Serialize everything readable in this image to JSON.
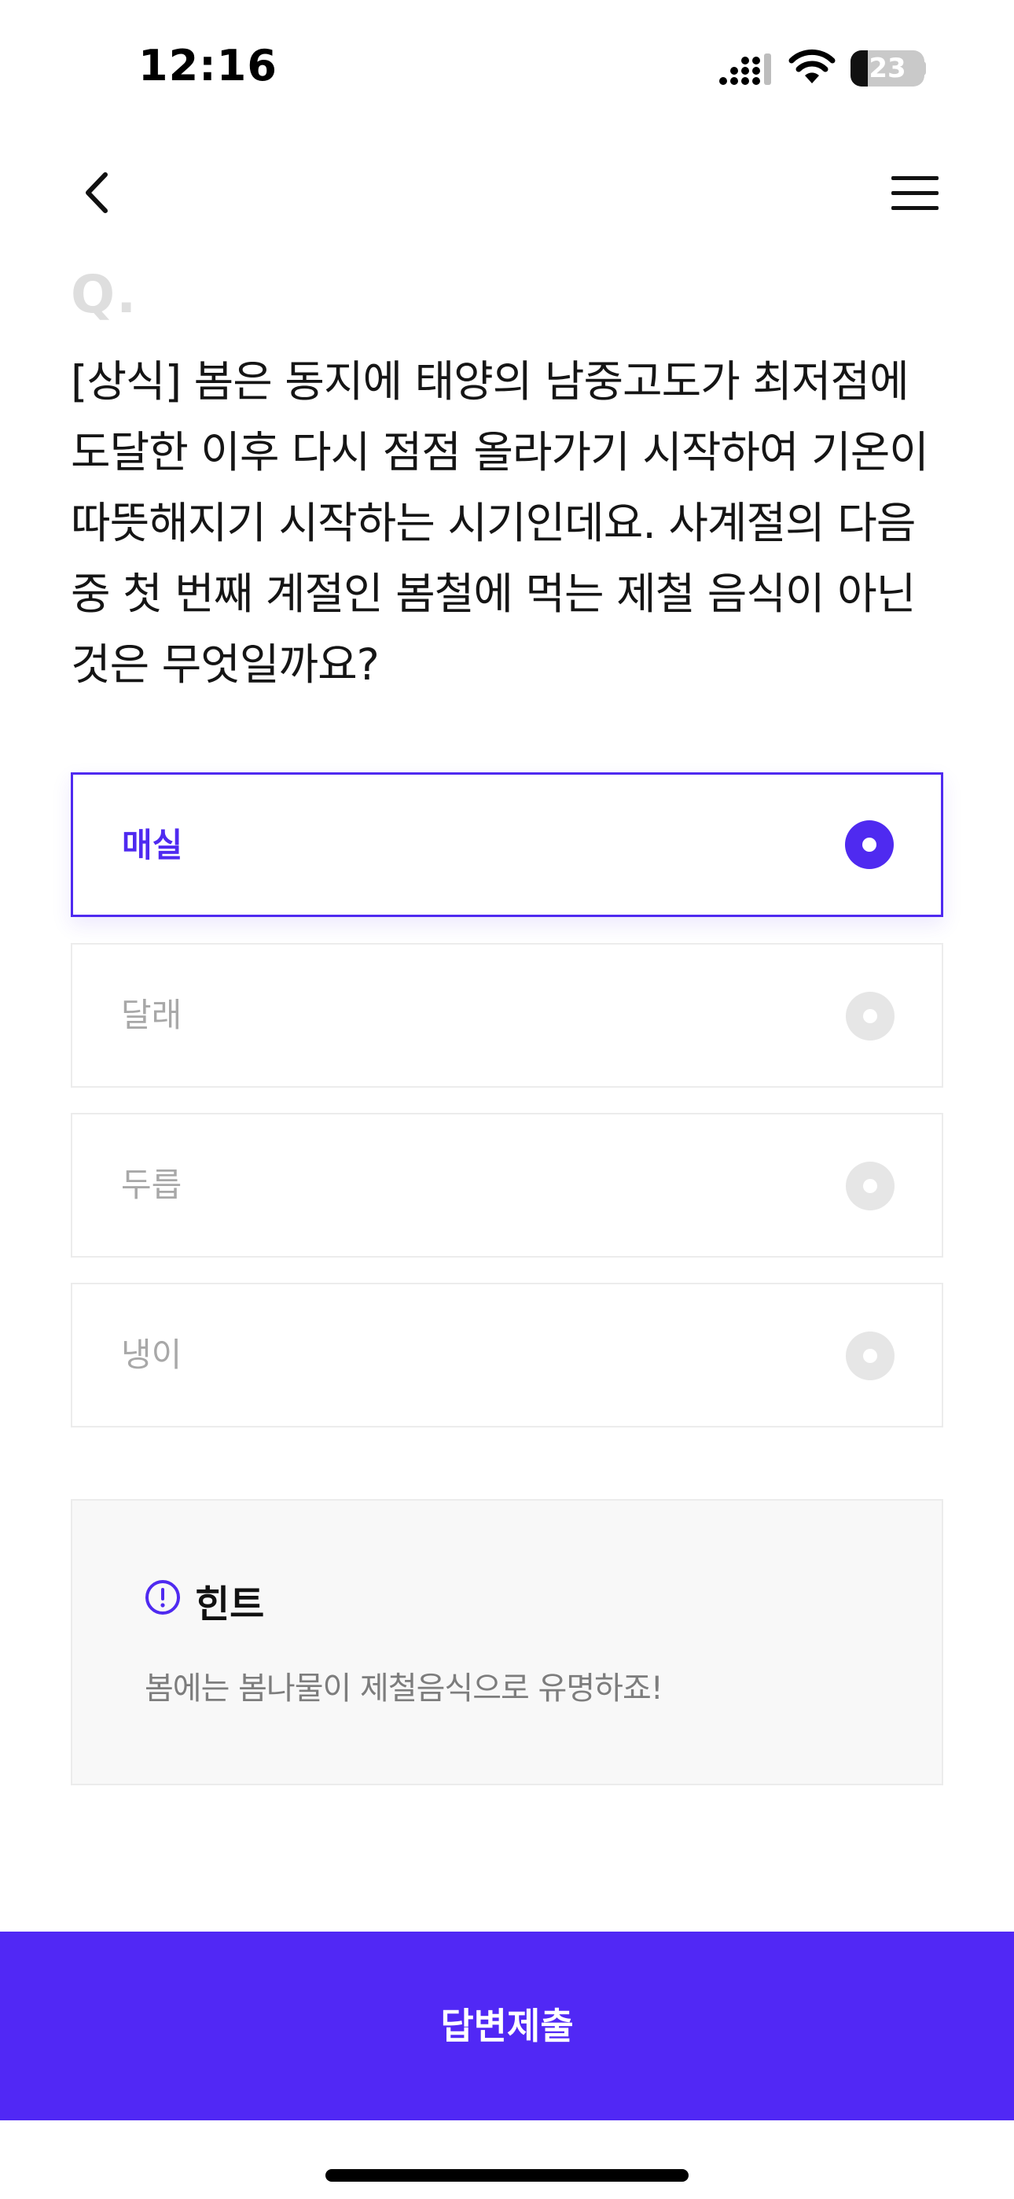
{
  "status_bar": {
    "time": "12:16",
    "battery_level": "23",
    "battery_fraction": 0.23,
    "icons": [
      "cellular-signal-icon",
      "wifi-icon",
      "battery-icon"
    ]
  },
  "nav": {
    "back_icon": "chevron-left-icon",
    "menu_icon": "hamburger-menu-icon"
  },
  "question": {
    "marker": "Q.",
    "text": "[상식] 봄은 동지에 태양의 남중고도가 최저점에 도달한 이후 다시 점점 올라가기 시작하여 기온이 따뜻해지기 시작하는 시기인데요. 사계절의 다음 중 첫 번째 계절인 봄철에 먹는 제철 음식이 아닌 것은 무엇일까요?"
  },
  "options": [
    {
      "label": "매실",
      "selected": true
    },
    {
      "label": "달래",
      "selected": false
    },
    {
      "label": "두릅",
      "selected": false
    },
    {
      "label": "냉이",
      "selected": false
    }
  ],
  "hint": {
    "icon": "exclamation-circle-icon",
    "title": "힌트",
    "text": "봄에는 봄나물이 제철음식으로 유명하죠!"
  },
  "submit": {
    "label": "답변제출"
  },
  "colors": {
    "accent": "#5128f5",
    "unselected_radio": "#e6e6e6",
    "hint_background": "#f8f8f8"
  }
}
